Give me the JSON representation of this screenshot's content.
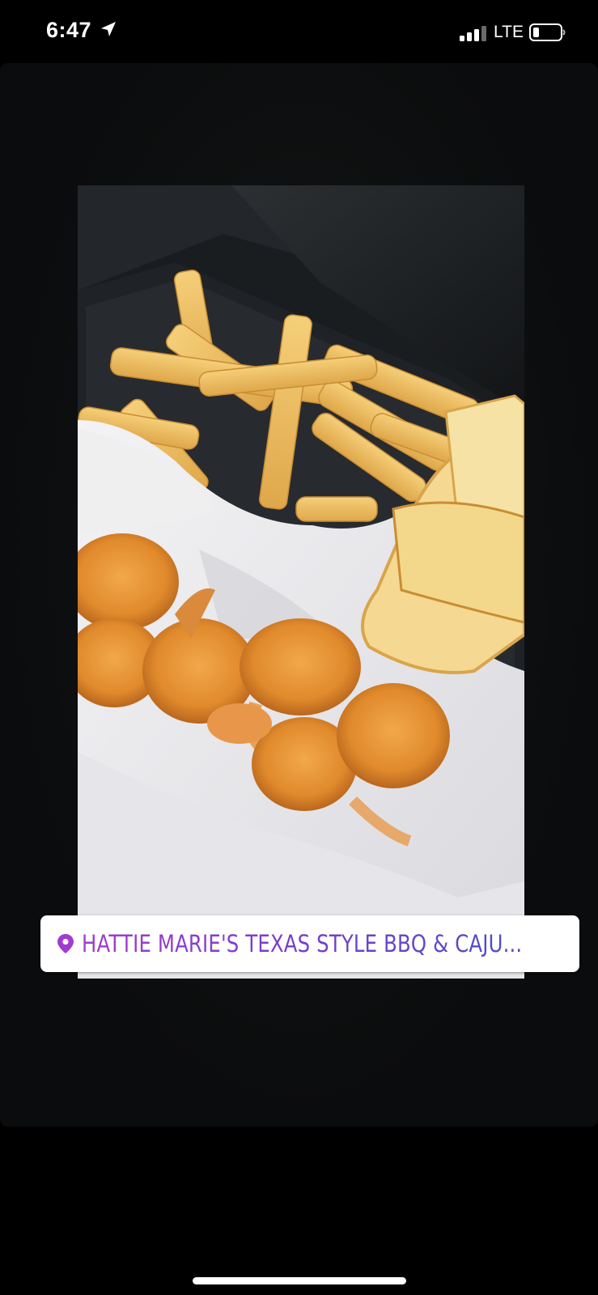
{
  "status_bar": {
    "time": "6:47",
    "network": "LTE",
    "icons": [
      "location-arrow-icon",
      "signal-icon",
      "battery-icon"
    ]
  },
  "story": {
    "photo_subject": "takeout-food-photo",
    "location_sticker": {
      "icon": "location-pin-icon",
      "text": "HATTIE MARIE'S TEXAS STYLE BBQ & CAJU..."
    }
  },
  "colors": {
    "background": "#000000",
    "sticker_gradient_start": "#a03ccf",
    "sticker_gradient_end": "#4c4fc6"
  }
}
